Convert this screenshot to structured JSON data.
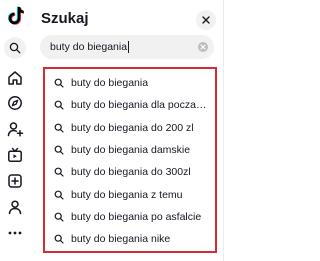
{
  "app": {
    "logo_icon": "tiktok-logo",
    "accent_color": "#d62a36"
  },
  "rail": {
    "items": [
      {
        "name": "search",
        "icon": "search-icon"
      },
      {
        "name": "home",
        "icon": "home-icon"
      },
      {
        "name": "explore",
        "icon": "compass-icon"
      },
      {
        "name": "following",
        "icon": "user-add-icon"
      },
      {
        "name": "live",
        "icon": "live-tv-icon"
      },
      {
        "name": "upload",
        "icon": "plus-square-icon"
      },
      {
        "name": "profile",
        "icon": "profile-icon"
      },
      {
        "name": "more",
        "icon": "more-icon"
      }
    ]
  },
  "search_panel": {
    "title": "Szukaj",
    "close_icon": "close-icon",
    "query": "buty do biegania",
    "clear_icon": "clear-icon",
    "suggestions": [
      "buty do biegania",
      "buty do biegania dla poczatkujących",
      "buty do biegania do 200 zl",
      "buty do biegania damskie",
      "buty do biegania do 300zl",
      "buty do biegania z temu",
      "buty do biegania po asfalcie",
      "buty do biegania nike"
    ]
  }
}
